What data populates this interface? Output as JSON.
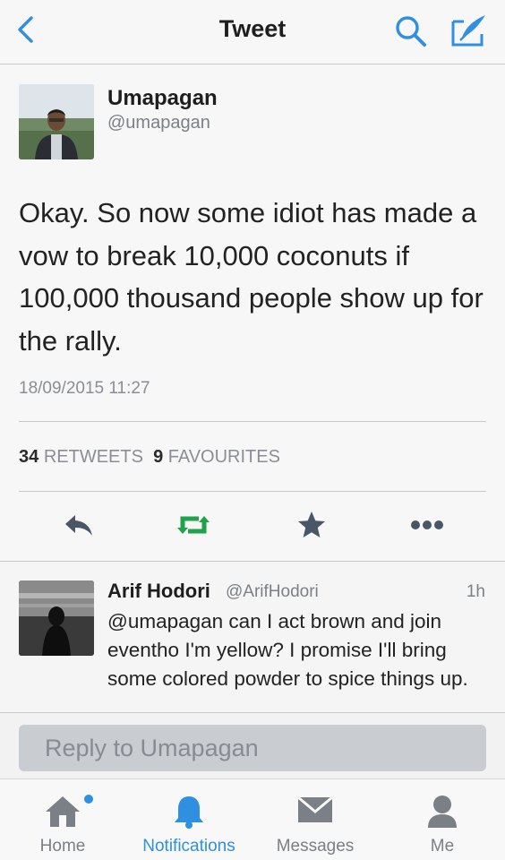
{
  "nav": {
    "title": "Tweet"
  },
  "tweet": {
    "author_name": "Umapagan",
    "author_handle": "@umapagan",
    "text": "Okay. So now some idiot has made a vow to break 10,000 coconuts if 100,000 thousand people show up for the rally.",
    "timestamp": "18/09/2015 11:27",
    "retweets_count": "34",
    "retweets_label": "RETWEETS",
    "favourites_count": "9",
    "favourites_label": "FAVOURITES"
  },
  "reply": {
    "author_name": "Arif Hodori",
    "author_handle": "@ArifHodori",
    "time": "1h",
    "text": "@umapagan can I act brown and join eventho I'm yellow? I promise I'll bring some colored powder to spice things up."
  },
  "reply_input": {
    "placeholder": "Reply to Umapagan"
  },
  "tabs": [
    {
      "label": "Home",
      "icon": "home-icon"
    },
    {
      "label": "Notifications",
      "icon": "bell-icon",
      "active": true
    },
    {
      "label": "Messages",
      "icon": "envelope-icon"
    },
    {
      "label": "Me",
      "icon": "person-icon"
    }
  ],
  "colors": {
    "accent": "#2f8fe0",
    "retweet_green": "#1fa24a",
    "icon_gray": "#7b8087",
    "icon_dark": "#4a5566"
  }
}
